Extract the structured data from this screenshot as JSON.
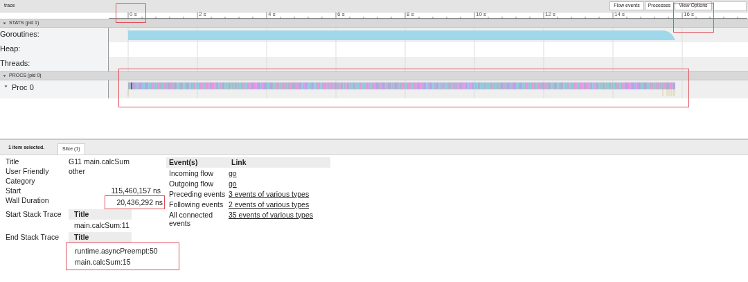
{
  "title": "trace",
  "buttons": [
    "Flow events",
    "Processes",
    "View Options"
  ],
  "ruler": {
    "ticks": [
      "0 s",
      "2 s",
      "4 s",
      "6 s",
      "8 s",
      "10 s",
      "12 s",
      "14 s",
      "16 s"
    ]
  },
  "groups": [
    {
      "label": "STATS (pid 1)",
      "expanded": true,
      "tracks": [
        {
          "label": "Goroutines:",
          "kind": "counter"
        },
        {
          "label": "Heap:",
          "kind": "empty"
        },
        {
          "label": "Threads:",
          "kind": "empty"
        }
      ]
    },
    {
      "label": "PROCS (pid 0)",
      "expanded": true,
      "tracks": [
        {
          "label": "Proc 0",
          "kind": "slices",
          "expanded": true
        }
      ]
    }
  ],
  "selection": {
    "summary": "1 item selected.",
    "tabs": [
      {
        "label": "Slice (1)",
        "selected": true
      }
    ]
  },
  "details": [
    {
      "kind": "text",
      "label": "Title",
      "value": "G11 main.calcSum",
      "highlighted": false
    },
    {
      "kind": "text",
      "label": "User Friendly Category",
      "value": "other",
      "highlighted": false
    },
    {
      "kind": "number",
      "label": "Start",
      "value": "115,460,157 ns",
      "highlighted": false
    },
    {
      "kind": "number",
      "label": "Wall Duration",
      "value": "20,436,292 ns",
      "highlighted": true
    },
    {
      "kind": "stack",
      "label": "Start Stack Trace",
      "heading": "Title",
      "frames": [
        "main.calcSum:11"
      ],
      "highlighted": false
    },
    {
      "kind": "stack",
      "label": "End Stack Trace",
      "heading": "Title",
      "frames": [
        "runtime.asyncPreempt:50",
        "main.calcSum:15"
      ],
      "highlighted": true
    }
  ],
  "events": {
    "columns": [
      "Event(s)",
      "Link"
    ],
    "rows": [
      {
        "event": "Incoming flow",
        "link": "go"
      },
      {
        "event": "Outgoing flow",
        "link": "go"
      },
      {
        "event": "Preceding events",
        "link": "3 events of various types"
      },
      {
        "event": "Following events",
        "link": "2 events of various types"
      },
      {
        "event": "All connected events",
        "link": "35 events of various types"
      }
    ]
  }
}
